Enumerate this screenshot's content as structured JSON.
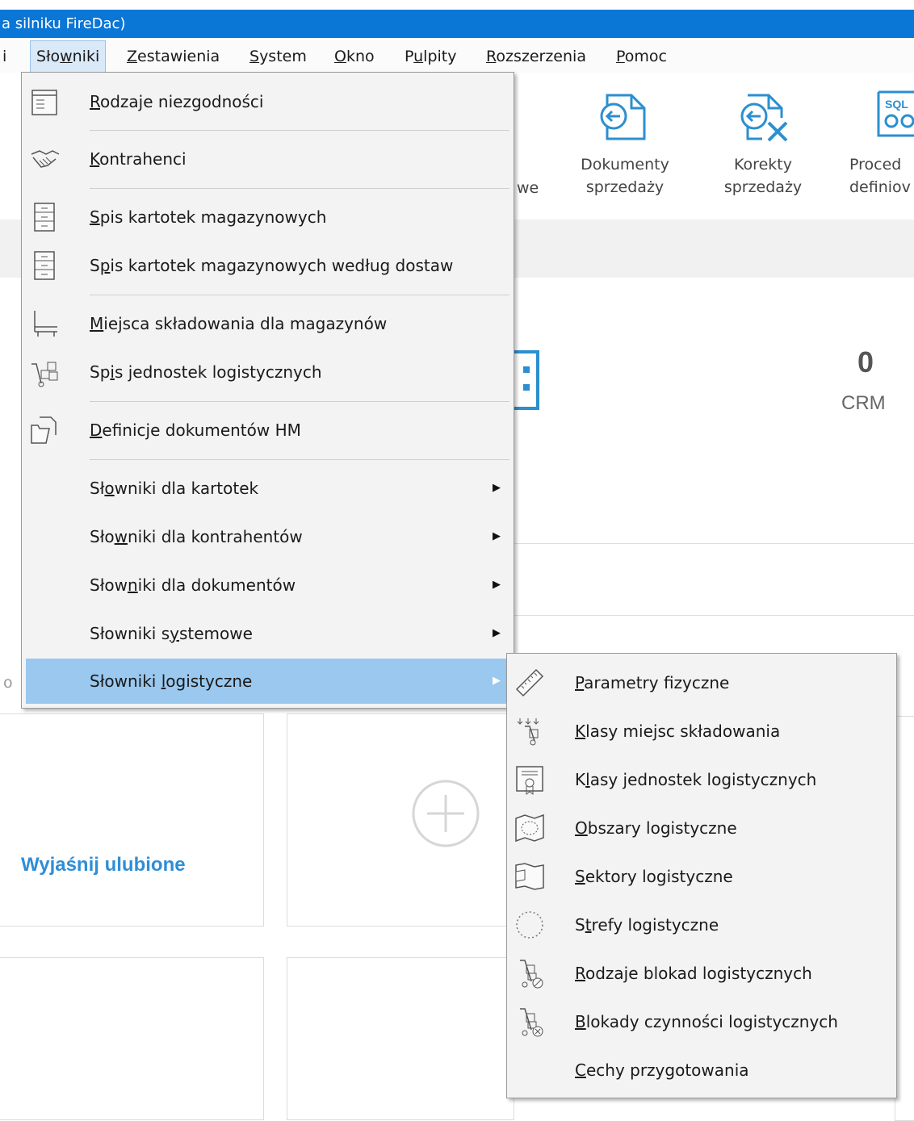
{
  "title_fragment": "a silniku FireDac)",
  "menubar": {
    "stub": "i",
    "items": [
      {
        "pre": "Sło",
        "ul": "w",
        "post": "niki"
      },
      {
        "pre": "",
        "ul": "Z",
        "post": "estawienia"
      },
      {
        "pre": "",
        "ul": "S",
        "post": "ystem"
      },
      {
        "pre": "",
        "ul": "O",
        "post": "kno"
      },
      {
        "pre": "P",
        "ul": "u",
        "post": "lpity"
      },
      {
        "pre": "",
        "ul": "R",
        "post": "ozszerzenia"
      },
      {
        "pre": "",
        "ul": "P",
        "post": "omoc"
      }
    ]
  },
  "ribbon": {
    "partial_label": "we",
    "buttons": [
      {
        "line1": "Dokumenty",
        "line2": "sprzedaży",
        "icon": "document-arrow-icon"
      },
      {
        "line1": "Korekty",
        "line2": "sprzedaży",
        "icon": "document-correction-icon"
      },
      {
        "line1": "Proced",
        "line2": "definiov",
        "icon": "sql-procedure-icon"
      }
    ]
  },
  "dashboard": {
    "count_value": "0",
    "count_label": "CRM",
    "favorites_text": "Wyjaśnij ulubione",
    "stub_letter": "o"
  },
  "menu": {
    "items": [
      {
        "pre": "",
        "ul": "R",
        "post": "odzaje niezgodności",
        "icon": "list-window-icon"
      },
      {
        "pre": "",
        "ul": "K",
        "post": "ontrahenci",
        "icon": "handshake-icon"
      },
      {
        "pre": "",
        "ul": "S",
        "post": "pis kartotek magazynowych",
        "icon": "file-cabinet-icon"
      },
      {
        "pre": "S",
        "ul": "p",
        "post": "is kartotek magazynowych według dostaw",
        "icon": "file-cabinet-icon"
      },
      {
        "pre": "",
        "ul": "M",
        "post": "iejsca składowania dla magazynów",
        "icon": "storage-rack-icon"
      },
      {
        "pre": "Sp",
        "ul": "i",
        "post": "s jednostek logistycznych",
        "icon": "boxes-trolley-icon"
      },
      {
        "pre": "",
        "ul": "D",
        "post": "efinicje dokumentów HM",
        "icon": "document-folder-icon"
      },
      {
        "pre": "Sł",
        "ul": "o",
        "post": "wniki dla kartotek",
        "icon": ""
      },
      {
        "pre": "Sło",
        "ul": "w",
        "post": "niki dla kontrahentów",
        "icon": ""
      },
      {
        "pre": "Słow",
        "ul": "n",
        "post": "iki dla dokumentów",
        "icon": ""
      },
      {
        "pre": "Słowniki s",
        "ul": "y",
        "post": "stemowe",
        "icon": ""
      },
      {
        "pre": "Słowniki ",
        "ul": "l",
        "post": "ogistyczne",
        "icon": ""
      }
    ]
  },
  "submenu": {
    "items": [
      {
        "pre": "",
        "ul": "P",
        "post": "arametry fizyczne",
        "icon": "ruler-icon"
      },
      {
        "pre": "",
        "ul": "K",
        "post": "lasy miejsc składowania",
        "icon": "hand-truck-arrows-icon"
      },
      {
        "pre": "K",
        "ul": "l",
        "post": "asy jednostek logistycznych",
        "icon": "certificate-icon"
      },
      {
        "pre": "",
        "ul": "O",
        "post": "bszary logistyczne",
        "icon": "map-area-icon"
      },
      {
        "pre": "",
        "ul": "S",
        "post": "ektory logistyczne",
        "icon": "map-sector-icon"
      },
      {
        "pre": "S",
        "ul": "t",
        "post": "refy logistyczne",
        "icon": "dashed-circle-icon"
      },
      {
        "pre": "",
        "ul": "R",
        "post": "odzaje blokad logistycznych",
        "icon": "hand-truck-block-icon"
      },
      {
        "pre": "",
        "ul": "B",
        "post": "lokady czynności logistycznych",
        "icon": "hand-truck-cancel-icon"
      },
      {
        "pre": "",
        "ul": "C",
        "post": "echy przygotowania",
        "icon": ""
      }
    ]
  },
  "colors": {
    "titlebar": "#0a76d6",
    "highlight": "#9ac8ef",
    "accent_text": "#2f8ed6",
    "ribbon_icon": "#2b8fd0"
  }
}
